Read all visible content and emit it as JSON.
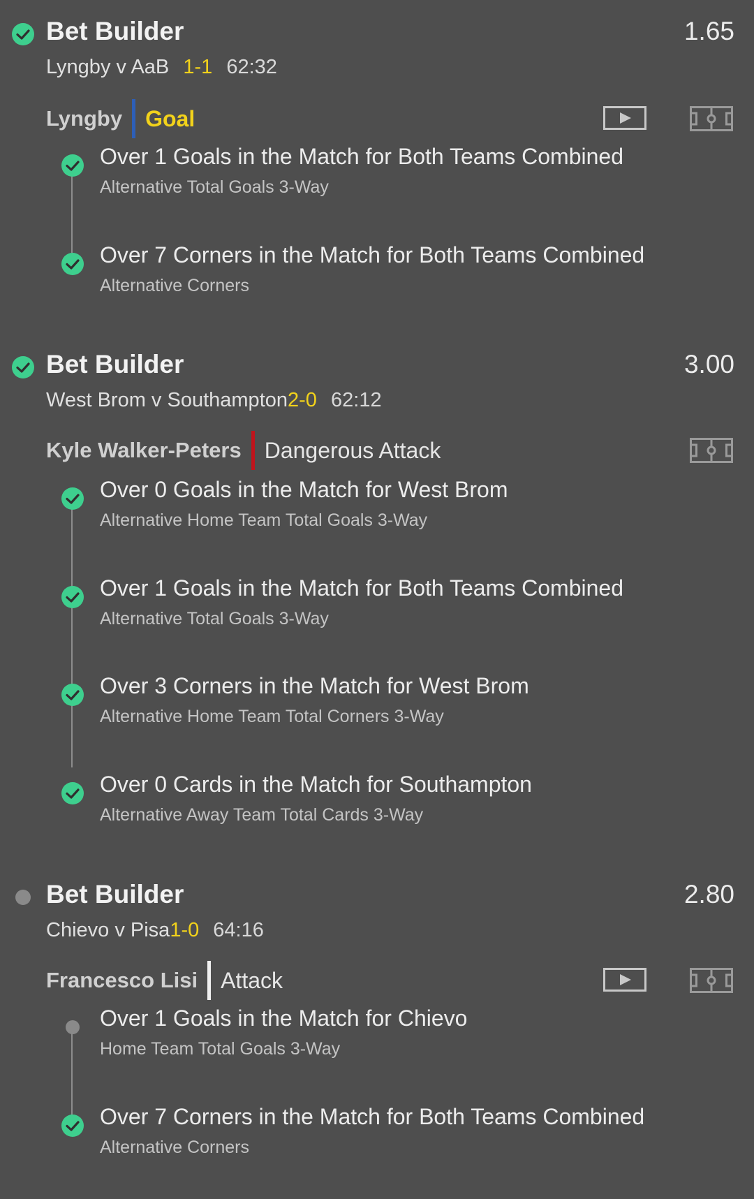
{
  "colors": {
    "background": "#4e4e4e",
    "success_green": "#3ecf8e",
    "score_yellow": "#f2d21b",
    "goal_divider_blue": "#2d5fb8",
    "attack_divider_red": "#c0141c",
    "attack_divider_white": "#f0f0f0",
    "pending_grey": "#8a8a8a"
  },
  "bets": [
    {
      "status": "won",
      "title": "Bet Builder",
      "odds": "1.65",
      "match": "Lyngby v AaB",
      "score": "1-1",
      "clock": "62:32",
      "player": "Lyngby",
      "event": "Goal",
      "event_color": "#f2d21b",
      "divider_color": "#2d5fb8",
      "has_video": true,
      "icons": [
        "check-circle-icon",
        "play-video-icon",
        "pitch-icon"
      ],
      "legs": [
        {
          "status": "won",
          "selection": "Over 1 Goals in the Match for Both Teams Combined",
          "market": "Alternative Total Goals 3-Way"
        },
        {
          "status": "won",
          "selection": "Over 7 Corners in the Match for Both Teams Combined",
          "market": "Alternative Corners"
        }
      ]
    },
    {
      "status": "won",
      "title": "Bet Builder",
      "odds": "3.00",
      "match": "West Brom v Southampton",
      "score": "2-0",
      "clock": "62:12",
      "player": "Kyle Walker-Peters",
      "event": "Dangerous Attack",
      "event_color": "#e6e6e6",
      "divider_color": "#c0141c",
      "has_video": false,
      "icons": [
        "check-circle-icon",
        "pitch-icon"
      ],
      "legs": [
        {
          "status": "won",
          "selection": "Over 0 Goals in the Match for West Brom",
          "market": "Alternative Home Team Total Goals 3-Way"
        },
        {
          "status": "won",
          "selection": "Over 1 Goals in the Match for Both Teams Combined",
          "market": "Alternative Total Goals 3-Way"
        },
        {
          "status": "won",
          "selection": "Over 3 Corners in the Match for West Brom",
          "market": "Alternative Home Team Total Corners 3-Way"
        },
        {
          "status": "won",
          "selection": "Over 0 Cards in the Match for Southampton",
          "market": "Alternative Away Team Total Cards 3-Way"
        }
      ]
    },
    {
      "status": "pending",
      "title": "Bet Builder",
      "odds": "2.80",
      "match": "Chievo v Pisa",
      "score": "1-0",
      "clock": "64:16",
      "player": "Francesco Lisi",
      "event": "Attack",
      "event_color": "#e6e6e6",
      "divider_color": "#f0f0f0",
      "has_video": true,
      "icons": [
        "pending-dot-icon",
        "play-video-icon",
        "pitch-icon"
      ],
      "legs": [
        {
          "status": "pending",
          "selection": "Over 1 Goals in the Match for Chievo",
          "market": "Home Team Total Goals 3-Way"
        },
        {
          "status": "won",
          "selection": "Over 7 Corners in the Match for Both Teams Combined",
          "market": "Alternative Corners"
        }
      ]
    }
  ]
}
